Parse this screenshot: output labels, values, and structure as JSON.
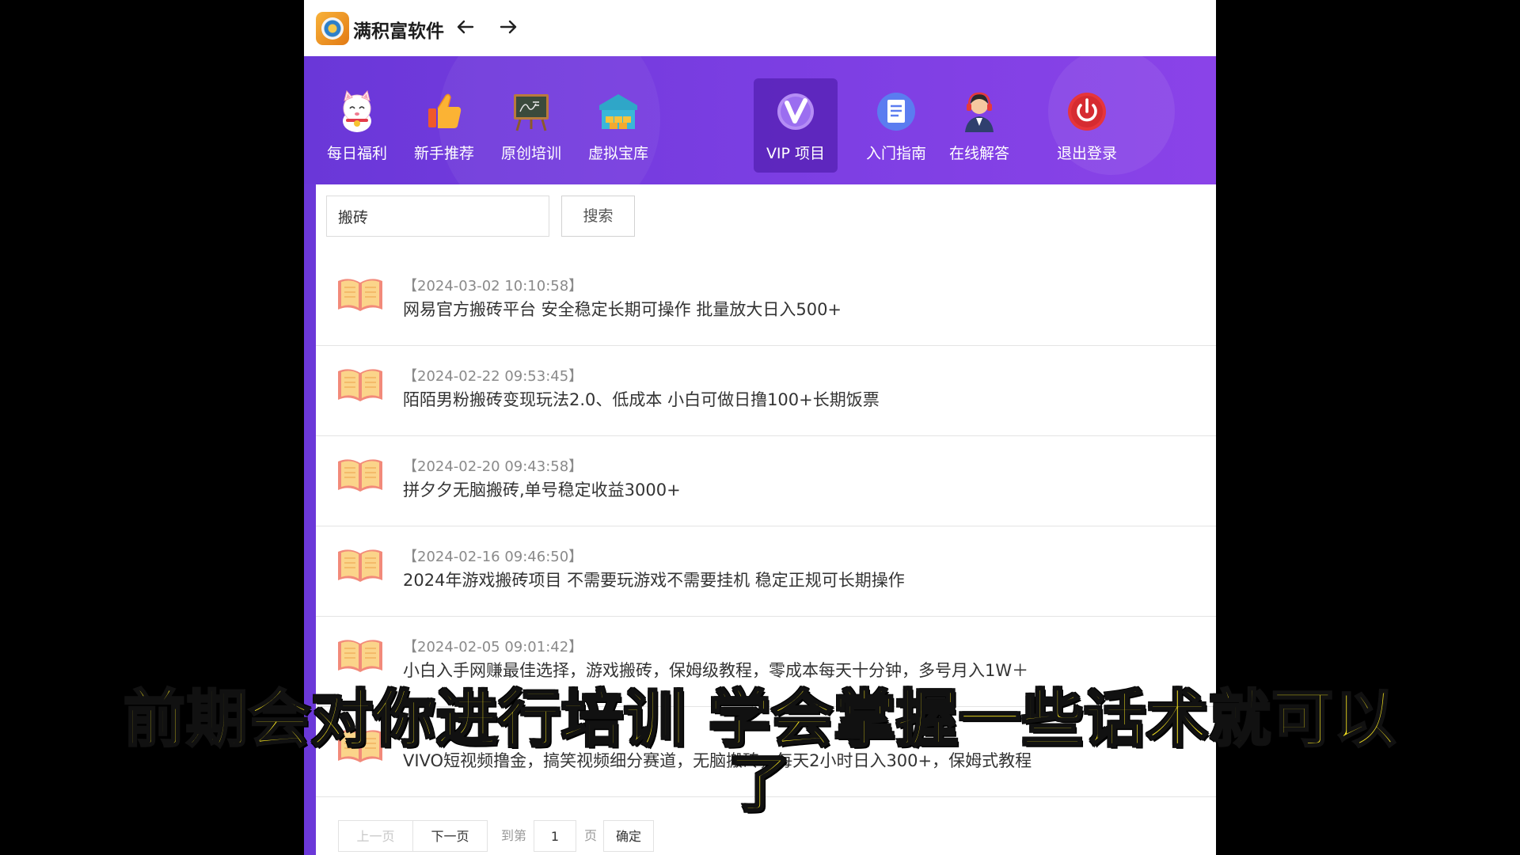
{
  "titlebar": {
    "app_title": "满积富软件"
  },
  "nav": {
    "items": [
      {
        "label": "每日福利",
        "icon": "lucky-cat-icon"
      },
      {
        "label": "新手推荐",
        "icon": "thumbs-up-icon"
      },
      {
        "label": "原创培训",
        "icon": "chalkboard-icon"
      },
      {
        "label": "虚拟宝库",
        "icon": "warehouse-icon"
      },
      {
        "label": "VIP 项目",
        "icon": "vip-icon",
        "active": true
      },
      {
        "label": "入门指南",
        "icon": "document-icon"
      },
      {
        "label": "在线解答",
        "icon": "support-agent-icon"
      },
      {
        "label": "退出登录",
        "icon": "power-icon"
      }
    ]
  },
  "search": {
    "value": "搬砖",
    "button_label": "搜索"
  },
  "articles": [
    {
      "date": "【2024-03-02 10:10:58】",
      "title": "网易官方搬砖平台 安全稳定长期可操作 批量放大日入500+"
    },
    {
      "date": "【2024-02-22 09:53:45】",
      "title": "陌陌男粉搬砖变现玩法2.0、低成本 小白可做日撸100+长期饭票"
    },
    {
      "date": "【2024-02-20 09:43:58】",
      "title": "拼夕夕无脑搬砖,单号稳定收益3000+"
    },
    {
      "date": "【2024-02-16 09:46:50】",
      "title": "2024年游戏搬砖项目 不需要玩游戏不需要挂机 稳定正规可长期操作"
    },
    {
      "date": "【2024-02-05 09:01:42】",
      "title": "小白入手网赚最佳选择，游戏搬砖，保姆级教程，零成本每天十分钟，多号月入1W＋"
    },
    {
      "date": "",
      "title": "VIVO短视频撸金，搞笑视频细分赛道，无脑搬砖，每天2小时日入300+，保姆式教程"
    }
  ],
  "pagination": {
    "prev": "上一页",
    "next": "下一页",
    "goto_label": "到第",
    "page_value": "1",
    "page_unit": "页",
    "confirm": "确定"
  },
  "subtitle": {
    "line1": "前期会对你进行培训 学会掌握一些话术就可以",
    "line2": "了"
  },
  "colors": {
    "nav_purple": "#7b3ee2",
    "subtitle_yellow": "#fbe81f"
  }
}
